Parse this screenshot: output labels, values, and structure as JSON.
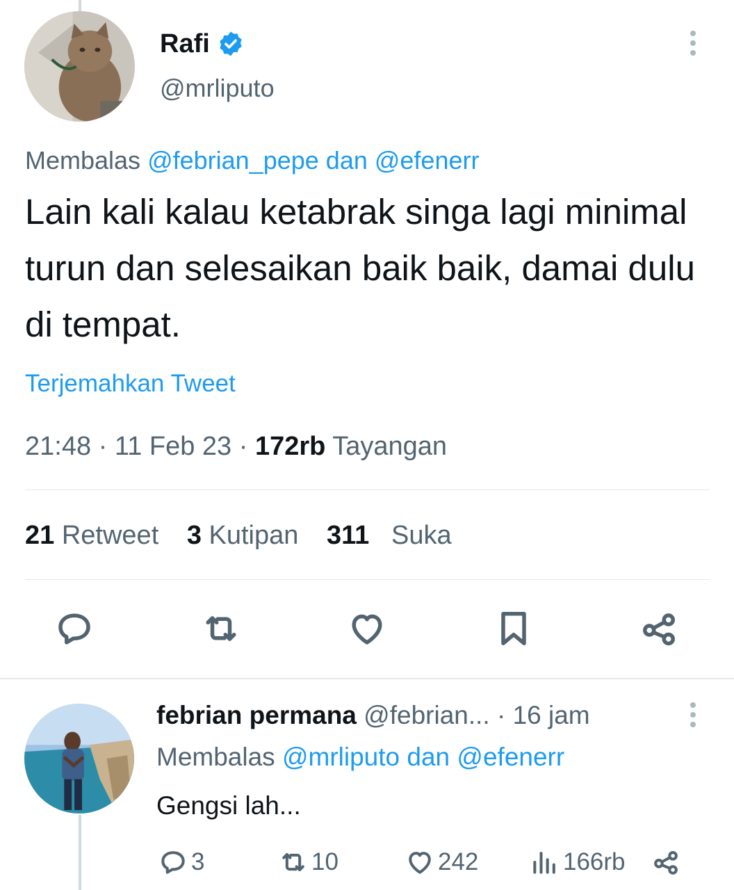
{
  "tweet": {
    "author_name": "Rafi",
    "author_handle": "@mrliputo",
    "reply_prefix": "Membalas ",
    "reply_targets": "@febrian_pepe dan @efenerr",
    "text": "Lain kali kalau ketabrak singa lagi minimal turun dan selesaikan baik baik, damai dulu di tempat.",
    "translate_label": "Terjemahkan Tweet",
    "time": "21:48",
    "date": "11 Feb 23",
    "views_count": "172rb",
    "views_label": "Tayangan",
    "separator": " · ",
    "retweet_count": "21",
    "retweet_label": "Retweet",
    "quote_count": "3",
    "quote_label": "Kutipan",
    "like_count": "311",
    "like_label": "Suka",
    "actions": [
      "reply-icon",
      "retweet-icon",
      "like-icon",
      "bookmark-icon",
      "share-icon"
    ]
  },
  "reply": {
    "author_name": "febrian permana",
    "author_handle": "@febrian...",
    "time": "· 16 jam",
    "reply_prefix": "Membalas ",
    "reply_targets": "@mrliputo dan @efenerr",
    "text": "Gengsi lah...",
    "reply_count": "3",
    "retweet_count": "10",
    "like_count": "242",
    "views_count": "166rb"
  },
  "colors": {
    "accent": "#1d9bf0",
    "text": "#0f1419",
    "secondary": "#536471",
    "divider": "#e1e8ed"
  }
}
